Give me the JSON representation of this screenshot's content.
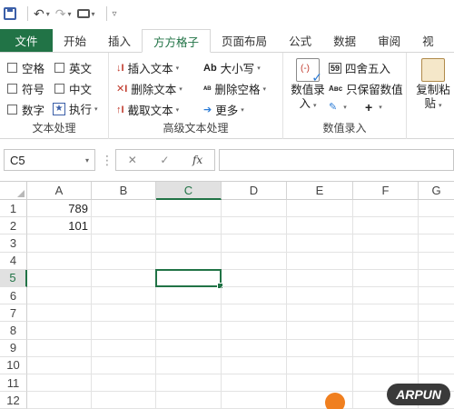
{
  "qat": {
    "undo": "↶",
    "redo": "↷"
  },
  "tabs": [
    "文件",
    "开始",
    "插入",
    "方方格子",
    "页面布局",
    "公式",
    "数据",
    "审阅",
    "视"
  ],
  "ribbon": {
    "text_group": {
      "label": "文本处理",
      "checks": [
        "空格",
        "英文",
        "符号",
        "中文",
        "数字"
      ],
      "execute": "执行"
    },
    "adv_group": {
      "label": "高级文本处理",
      "insert": "插入文本",
      "delete": "删除文本",
      "extract": "截取文本",
      "case": "大小写",
      "delete_space": "删除空格",
      "more": "更多"
    },
    "num_group": {
      "label": "数值录入",
      "entry": "数值录",
      "entry2": "入",
      "round": "四舍五入",
      "keep": "只保留数值"
    },
    "paste": {
      "line1": "复制粘",
      "line2": "贴"
    }
  },
  "formula_bar": {
    "name_box": "C5",
    "cancel": "✕",
    "enter": "✓",
    "fx": "fx"
  },
  "grid": {
    "columns": [
      "A",
      "B",
      "C",
      "D",
      "E",
      "F",
      "G"
    ],
    "rows": [
      "1",
      "2",
      "3",
      "4",
      "5",
      "6",
      "7",
      "8",
      "9",
      "10",
      "11",
      "12"
    ],
    "cells": {
      "A1": "789",
      "A2": "101"
    },
    "active_cell": "C5"
  },
  "watermark": {
    "text": "ARPUN"
  }
}
